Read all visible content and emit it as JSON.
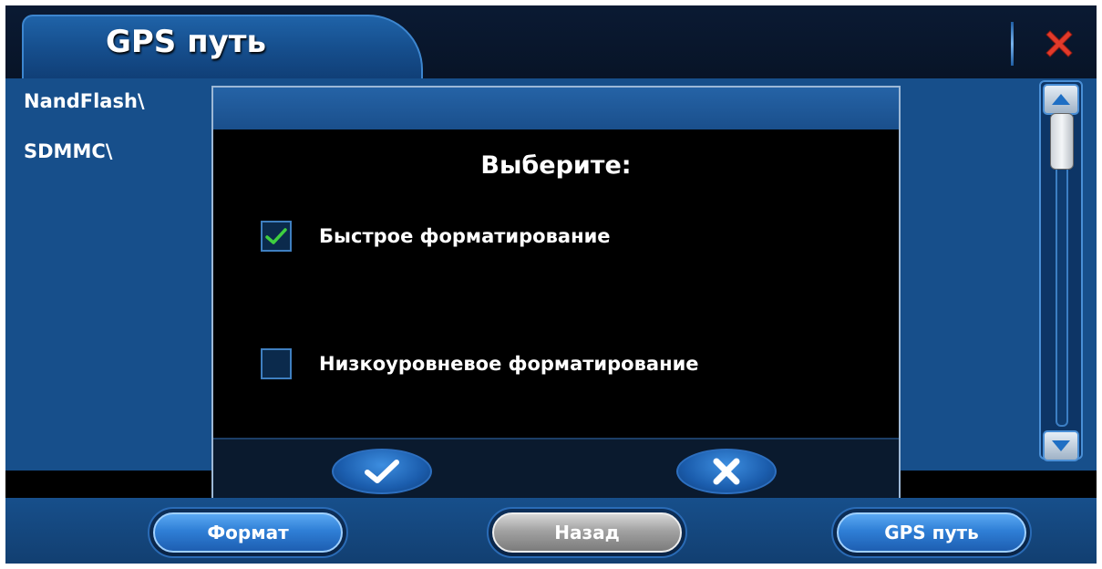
{
  "window": {
    "title": "GPS путь"
  },
  "file_list": {
    "items": [
      {
        "label": "NandFlash\\"
      },
      {
        "label": "SDMMC\\"
      }
    ]
  },
  "dialog": {
    "title": "Выберите:",
    "options": [
      {
        "label": "Быстрое форматирование",
        "checked": true
      },
      {
        "label": "Низкоуровневое форматирование",
        "checked": false
      }
    ]
  },
  "bottom_buttons": {
    "format": "Формат",
    "back": "Назад",
    "gps_path": "GPS путь"
  },
  "colors": {
    "panel": "#174f8b",
    "accent": "#2f7fd6",
    "close_red": "#e23a2a",
    "check_green": "#3fcf3f"
  }
}
